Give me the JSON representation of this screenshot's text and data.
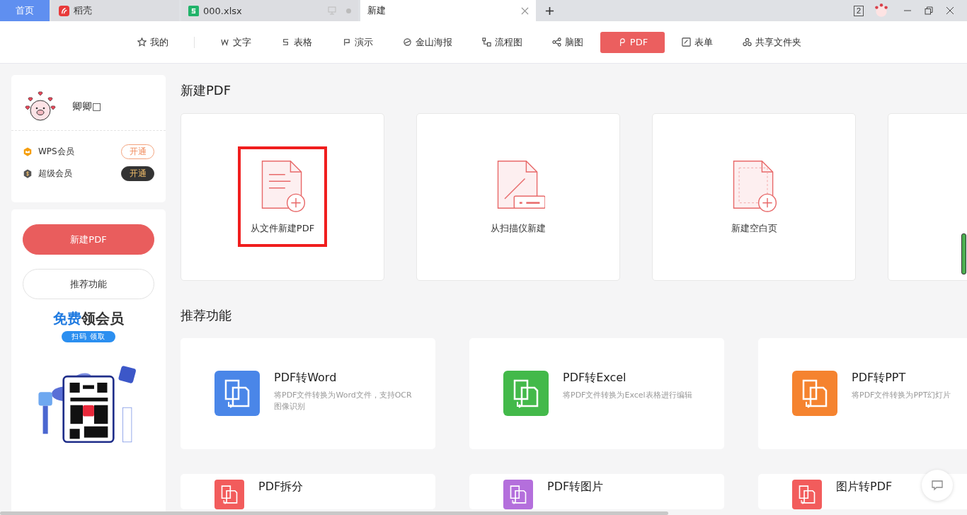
{
  "tabs": [
    {
      "label": "首页",
      "kind": "home",
      "selected": false
    },
    {
      "label": "稻壳",
      "kind": "docer",
      "selected": false
    },
    {
      "label": "000.xlsx",
      "kind": "sheet",
      "selected": false
    },
    {
      "label": "新建",
      "kind": "plain",
      "selected": true
    }
  ],
  "title_bar": {
    "window_count": "2"
  },
  "nav": [
    {
      "label": "我的",
      "kind": "star",
      "selected": false
    },
    {
      "label": "文字",
      "kind": "w",
      "selected": false
    },
    {
      "label": "表格",
      "kind": "s",
      "selected": false
    },
    {
      "label": "演示",
      "kind": "p",
      "selected": false
    },
    {
      "label": "金山海报",
      "kind": "poster",
      "selected": false
    },
    {
      "label": "流程图",
      "kind": "flow",
      "selected": false
    },
    {
      "label": "脑图",
      "kind": "mind",
      "selected": false
    },
    {
      "label": "PDF",
      "kind": "pdf",
      "selected": true
    },
    {
      "label": "表单",
      "kind": "form",
      "selected": false
    },
    {
      "label": "共享文件夹",
      "kind": "share",
      "selected": false
    }
  ],
  "profile": {
    "name": "卿卿□",
    "memberships": [
      {
        "name": "WPS会员",
        "kind": "wps",
        "action": "开通"
      },
      {
        "name": "超级会员",
        "kind": "super",
        "action": "开通"
      }
    ]
  },
  "side_buttons": [
    {
      "label": "新建PDF",
      "selected": true
    },
    {
      "label": "推荐功能",
      "selected": false
    }
  ],
  "promo": {
    "title_highlight": "免费",
    "title_rest": "领会员",
    "button": "扫码 领取"
  },
  "new_section": {
    "title": "新建PDF",
    "cards": [
      {
        "label": "从文件新建PDF",
        "kind": "file",
        "highlighted": true
      },
      {
        "label": "从扫描仪新建",
        "kind": "scanner",
        "highlighted": false
      },
      {
        "label": "新建空白页",
        "kind": "blank",
        "highlighted": false
      },
      {
        "kind": "partial",
        "highlighted": false
      }
    ]
  },
  "features_section": {
    "title": "推荐功能",
    "features": [
      {
        "title": "PDF转Word",
        "desc": "将PDF文件转换为Word文件，支持OCR图像识别",
        "color": "#4a86e8"
      },
      {
        "title": "PDF转Excel",
        "desc": "将PDF文件转换为Excel表格进行编辑",
        "color": "#43b94a"
      },
      {
        "title": "PDF转PPT",
        "desc": "将PDF文件转换为PPT幻灯片",
        "color": "#f5832f"
      },
      {
        "title": "PDF拆分",
        "color": "#f25c5c"
      },
      {
        "title": "PDF转图片",
        "color": "#b46fdc"
      },
      {
        "title": "图片转PDF",
        "color": "#f25c5c"
      }
    ]
  }
}
